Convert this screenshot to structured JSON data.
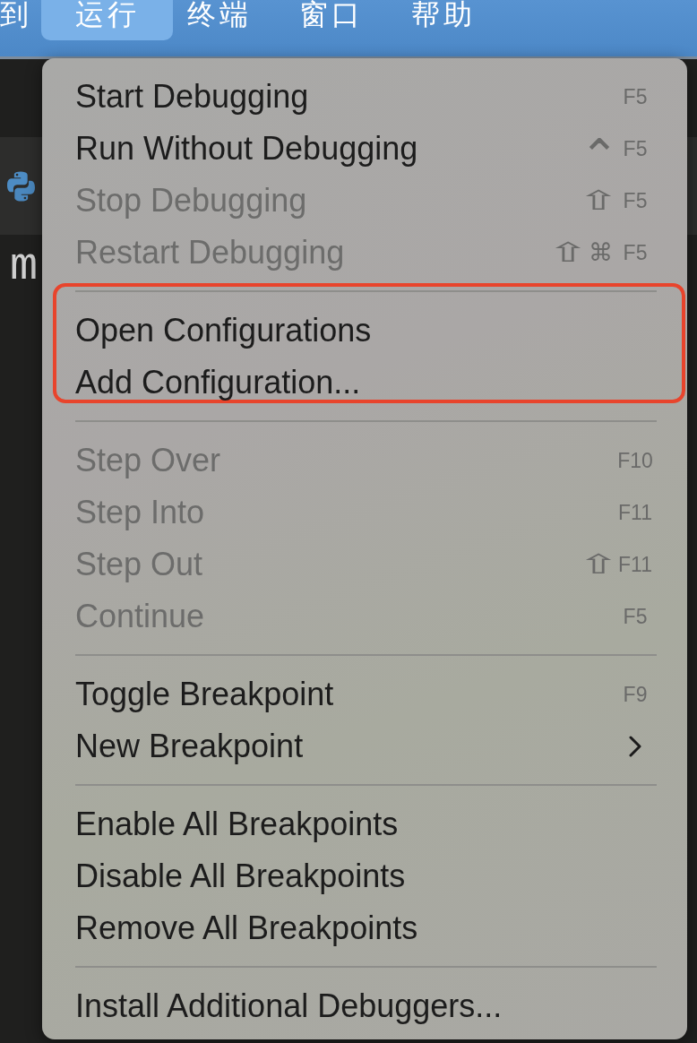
{
  "menu_bar": {
    "items": [
      {
        "label": "到",
        "selected": false
      },
      {
        "label": "运行",
        "selected": true
      },
      {
        "label": "终端",
        "selected": false
      },
      {
        "label": "窗口",
        "selected": false
      },
      {
        "label": "帮助",
        "selected": false
      }
    ]
  },
  "editor": {
    "text": "m"
  },
  "menu": {
    "groups": [
      {
        "highlighted": false,
        "items": [
          {
            "label": "Start Debugging",
            "disabled": false,
            "submenu": false,
            "key": "F5"
          },
          {
            "label": "Run Without Debugging",
            "disabled": false,
            "submenu": false,
            "modifiers": [
              {
                "kind": "control",
                "symbol": "⌃"
              }
            ],
            "key": "F5"
          },
          {
            "label": "Stop Debugging",
            "disabled": true,
            "submenu": false,
            "modifiers": [
              {
                "kind": "shift",
                "symbol": "⇧"
              }
            ],
            "key": "F5"
          },
          {
            "label": "Restart Debugging",
            "disabled": true,
            "submenu": false,
            "modifiers": [
              {
                "kind": "shift",
                "symbol": "⇧"
              },
              {
                "kind": "command",
                "symbol": "⌘"
              }
            ],
            "key": "F5"
          }
        ]
      },
      {
        "highlighted": true,
        "items": [
          {
            "label": "Open Configurations",
            "disabled": false,
            "submenu": false
          },
          {
            "label": "Add Configuration...",
            "disabled": false,
            "submenu": false
          }
        ]
      },
      {
        "highlighted": false,
        "items": [
          {
            "label": "Step Over",
            "disabled": true,
            "submenu": false,
            "key": "F10"
          },
          {
            "label": "Step Into",
            "disabled": true,
            "submenu": false,
            "key": "F11"
          },
          {
            "label": "Step Out",
            "disabled": true,
            "submenu": false,
            "modifiers": [
              {
                "kind": "shift",
                "symbol": "⇧"
              }
            ],
            "key": "F11"
          },
          {
            "label": "Continue",
            "disabled": true,
            "submenu": false,
            "key": "F5"
          }
        ]
      },
      {
        "highlighted": false,
        "items": [
          {
            "label": "Toggle Breakpoint",
            "disabled": false,
            "submenu": false,
            "key": "F9"
          },
          {
            "label": "New Breakpoint",
            "disabled": false,
            "submenu": true
          }
        ]
      },
      {
        "highlighted": false,
        "items": [
          {
            "label": "Enable All Breakpoints",
            "disabled": false,
            "submenu": false
          },
          {
            "label": "Disable All Breakpoints",
            "disabled": false,
            "submenu": false
          },
          {
            "label": "Remove All Breakpoints",
            "disabled": false,
            "submenu": false
          }
        ]
      },
      {
        "highlighted": false,
        "items": [
          {
            "label": "Install Additional Debuggers...",
            "disabled": false,
            "submenu": false
          }
        ]
      }
    ]
  }
}
